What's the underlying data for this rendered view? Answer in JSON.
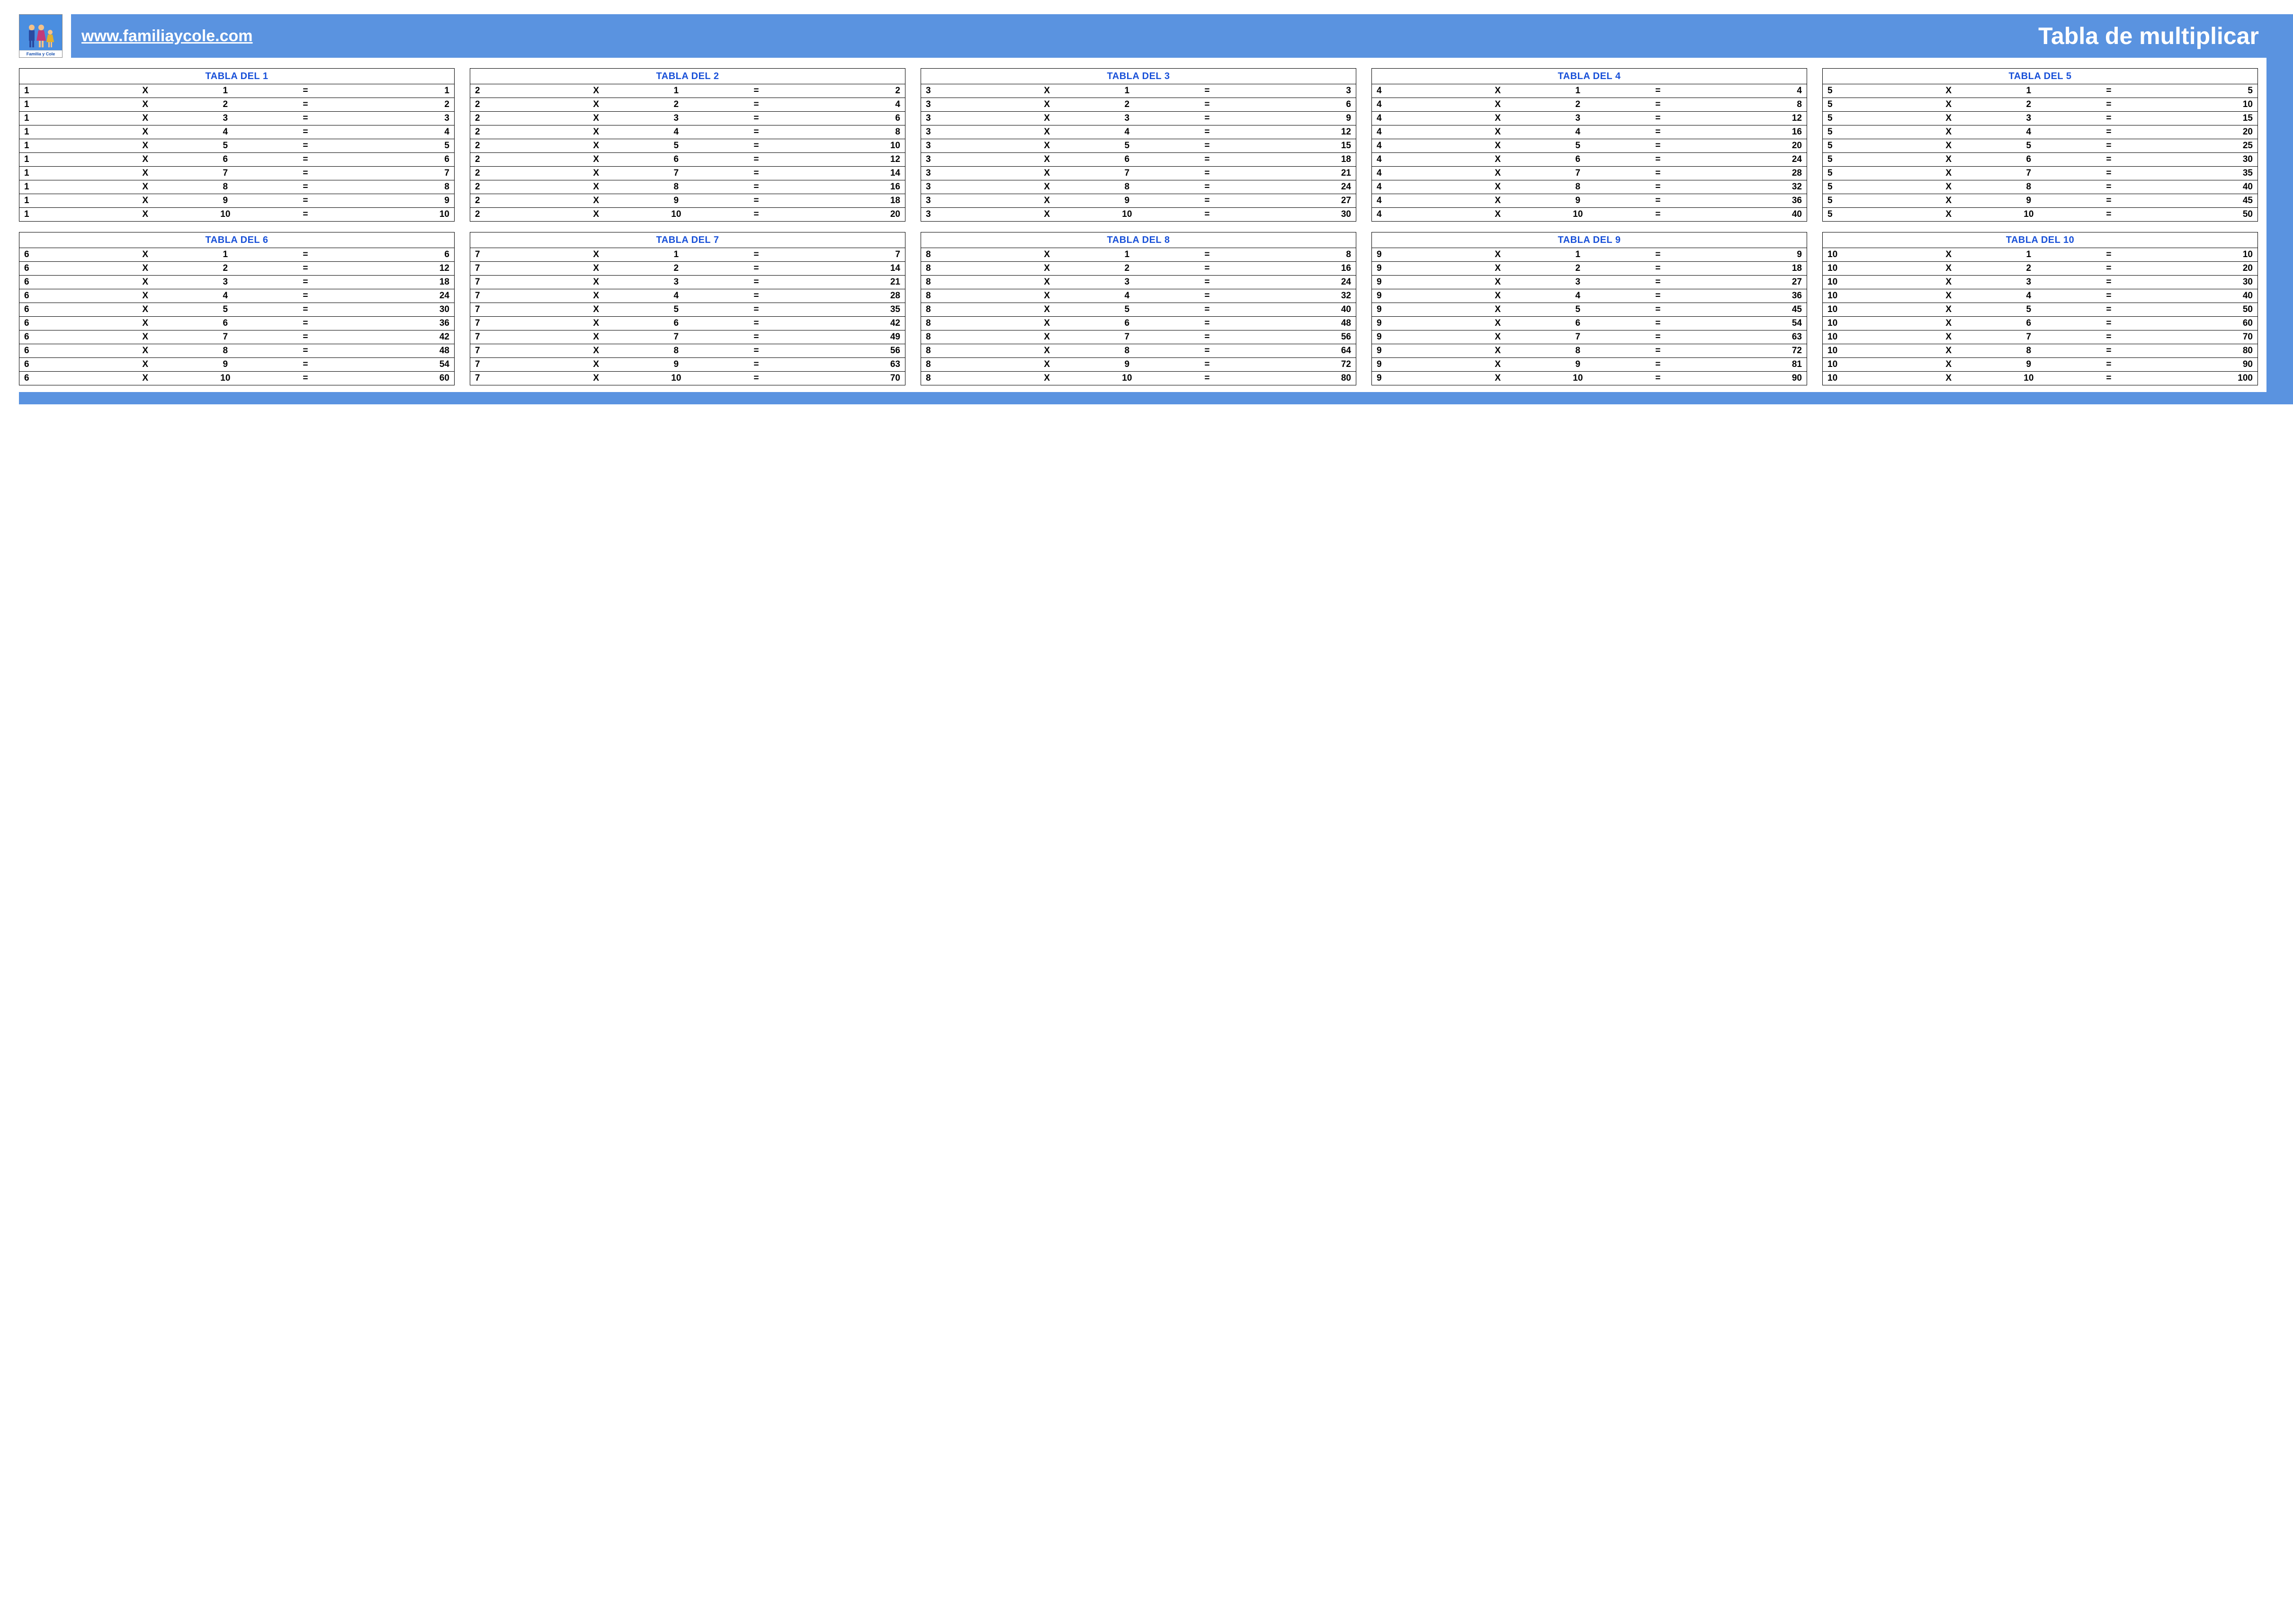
{
  "logo": {
    "caption": "Familia y Cole"
  },
  "banner": {
    "url": "www.familiaycole.com",
    "title": "Tabla de multiplicar"
  },
  "symbols": {
    "times": "X",
    "equals": "="
  },
  "tables": [
    {
      "title": "TABLA DEL 1",
      "rows": [
        [
          1,
          1,
          1
        ],
        [
          1,
          2,
          2
        ],
        [
          1,
          3,
          3
        ],
        [
          1,
          4,
          4
        ],
        [
          1,
          5,
          5
        ],
        [
          1,
          6,
          6
        ],
        [
          1,
          7,
          7
        ],
        [
          1,
          8,
          8
        ],
        [
          1,
          9,
          9
        ],
        [
          1,
          10,
          10
        ]
      ]
    },
    {
      "title": "TABLA DEL 2",
      "rows": [
        [
          2,
          1,
          2
        ],
        [
          2,
          2,
          4
        ],
        [
          2,
          3,
          6
        ],
        [
          2,
          4,
          8
        ],
        [
          2,
          5,
          10
        ],
        [
          2,
          6,
          12
        ],
        [
          2,
          7,
          14
        ],
        [
          2,
          8,
          16
        ],
        [
          2,
          9,
          18
        ],
        [
          2,
          10,
          20
        ]
      ]
    },
    {
      "title": "TABLA DEL 3",
      "rows": [
        [
          3,
          1,
          3
        ],
        [
          3,
          2,
          6
        ],
        [
          3,
          3,
          9
        ],
        [
          3,
          4,
          12
        ],
        [
          3,
          5,
          15
        ],
        [
          3,
          6,
          18
        ],
        [
          3,
          7,
          21
        ],
        [
          3,
          8,
          24
        ],
        [
          3,
          9,
          27
        ],
        [
          3,
          10,
          30
        ]
      ]
    },
    {
      "title": "TABLA DEL 4",
      "rows": [
        [
          4,
          1,
          4
        ],
        [
          4,
          2,
          8
        ],
        [
          4,
          3,
          12
        ],
        [
          4,
          4,
          16
        ],
        [
          4,
          5,
          20
        ],
        [
          4,
          6,
          24
        ],
        [
          4,
          7,
          28
        ],
        [
          4,
          8,
          32
        ],
        [
          4,
          9,
          36
        ],
        [
          4,
          10,
          40
        ]
      ]
    },
    {
      "title": "TABLA DEL 5",
      "rows": [
        [
          5,
          1,
          5
        ],
        [
          5,
          2,
          10
        ],
        [
          5,
          3,
          15
        ],
        [
          5,
          4,
          20
        ],
        [
          5,
          5,
          25
        ],
        [
          5,
          6,
          30
        ],
        [
          5,
          7,
          35
        ],
        [
          5,
          8,
          40
        ],
        [
          5,
          9,
          45
        ],
        [
          5,
          10,
          50
        ]
      ]
    },
    {
      "title": "TABLA DEL 6",
      "rows": [
        [
          6,
          1,
          6
        ],
        [
          6,
          2,
          12
        ],
        [
          6,
          3,
          18
        ],
        [
          6,
          4,
          24
        ],
        [
          6,
          5,
          30
        ],
        [
          6,
          6,
          36
        ],
        [
          6,
          7,
          42
        ],
        [
          6,
          8,
          48
        ],
        [
          6,
          9,
          54
        ],
        [
          6,
          10,
          60
        ]
      ]
    },
    {
      "title": "TABLA DEL 7",
      "rows": [
        [
          7,
          1,
          7
        ],
        [
          7,
          2,
          14
        ],
        [
          7,
          3,
          21
        ],
        [
          7,
          4,
          28
        ],
        [
          7,
          5,
          35
        ],
        [
          7,
          6,
          42
        ],
        [
          7,
          7,
          49
        ],
        [
          7,
          8,
          56
        ],
        [
          7,
          9,
          63
        ],
        [
          7,
          10,
          70
        ]
      ]
    },
    {
      "title": "TABLA DEL 8",
      "rows": [
        [
          8,
          1,
          8
        ],
        [
          8,
          2,
          16
        ],
        [
          8,
          3,
          24
        ],
        [
          8,
          4,
          32
        ],
        [
          8,
          5,
          40
        ],
        [
          8,
          6,
          48
        ],
        [
          8,
          7,
          56
        ],
        [
          8,
          8,
          64
        ],
        [
          8,
          9,
          72
        ],
        [
          8,
          10,
          80
        ]
      ]
    },
    {
      "title": "TABLA DEL 9",
      "rows": [
        [
          9,
          1,
          9
        ],
        [
          9,
          2,
          18
        ],
        [
          9,
          3,
          27
        ],
        [
          9,
          4,
          36
        ],
        [
          9,
          5,
          45
        ],
        [
          9,
          6,
          54
        ],
        [
          9,
          7,
          63
        ],
        [
          9,
          8,
          72
        ],
        [
          9,
          9,
          81
        ],
        [
          9,
          10,
          90
        ]
      ]
    },
    {
      "title": "TABLA DEL 10",
      "rows": [
        [
          10,
          1,
          10
        ],
        [
          10,
          2,
          20
        ],
        [
          10,
          3,
          30
        ],
        [
          10,
          4,
          40
        ],
        [
          10,
          5,
          50
        ],
        [
          10,
          6,
          60
        ],
        [
          10,
          7,
          70
        ],
        [
          10,
          8,
          80
        ],
        [
          10,
          9,
          90
        ],
        [
          10,
          10,
          100
        ]
      ]
    }
  ]
}
